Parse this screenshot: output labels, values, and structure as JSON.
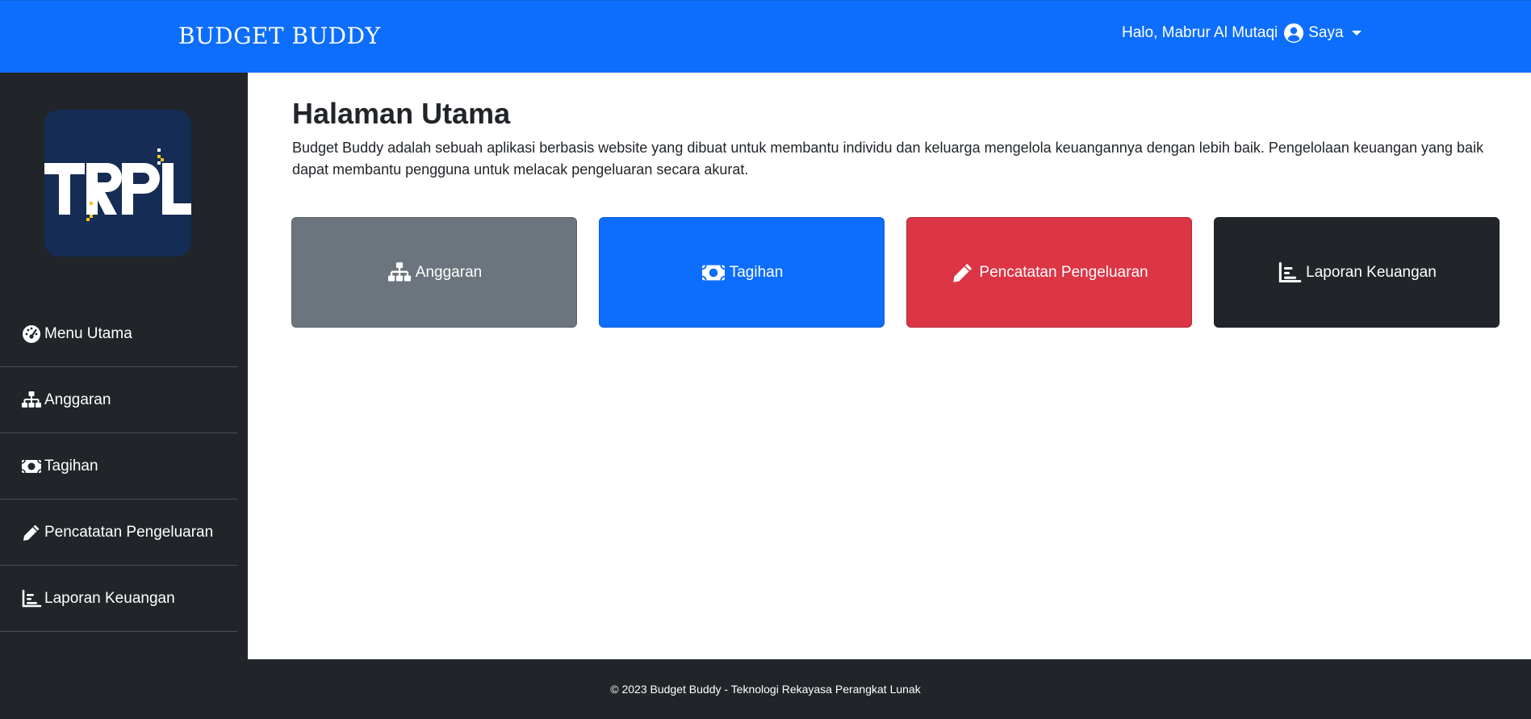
{
  "header": {
    "brand": "BUDGET BUDDY",
    "greeting": "Halo, Mabrur Al Mutaqi",
    "user_menu_label": "Saya",
    "background_color": "#0d6efd"
  },
  "sidebar": {
    "logo_text": "TRPL",
    "items": [
      {
        "label": "Menu Utama",
        "icon": "dashboard-icon"
      },
      {
        "label": "Anggaran",
        "icon": "sitemap-icon"
      },
      {
        "label": "Tagihan",
        "icon": "money-bill-icon"
      },
      {
        "label": "Pencatatan Pengeluaran",
        "icon": "pencil-icon"
      },
      {
        "label": "Laporan Keuangan",
        "icon": "chart-icon"
      }
    ],
    "background_color": "#212529"
  },
  "main": {
    "title": "Halaman Utama",
    "description": "Budget Buddy adalah sebuah aplikasi berbasis website yang dibuat untuk membantu individu dan keluarga mengelola keuangannya dengan lebih baik. Pengelolaan keuangan yang baik dapat membantu pengguna untuk melacak pengeluaran secara akurat.",
    "cards": [
      {
        "label": "Anggaran",
        "icon": "sitemap-icon",
        "color": "#6c757d"
      },
      {
        "label": "Tagihan",
        "icon": "money-bill-icon",
        "color": "#0d6efd"
      },
      {
        "label": "Pencatatan Pengeluaran",
        "icon": "pencil-icon",
        "color": "#dc3545"
      },
      {
        "label": "Laporan Keuangan",
        "icon": "chart-icon",
        "color": "#212529"
      }
    ]
  },
  "footer": {
    "text": "© 2023 Budget Buddy - Teknologi Rekayasa Perangkat Lunak"
  }
}
